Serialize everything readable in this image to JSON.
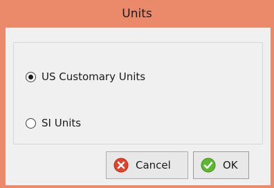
{
  "window": {
    "title": "Units"
  },
  "units": {
    "options": [
      {
        "label": "US Customary Units",
        "selected": true
      },
      {
        "label": "SI Units",
        "selected": false
      }
    ]
  },
  "buttons": {
    "cancel_label": "Cancel",
    "ok_label": "OK",
    "cancel_icon": "cancel-x-icon",
    "ok_icon": "checkmark-icon"
  },
  "colors": {
    "title_bar": "#ea8a6a",
    "client_bg": "#f0f0f0",
    "cancel_icon": "#e0442a",
    "ok_icon": "#5cb82e"
  }
}
